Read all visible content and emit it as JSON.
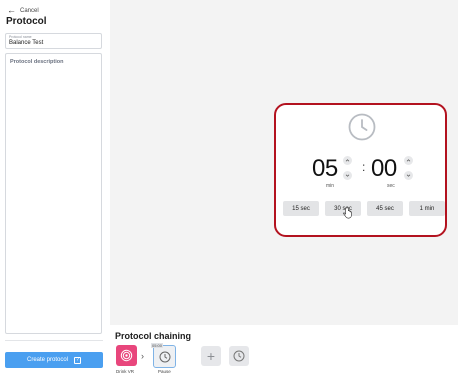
{
  "left_panel": {
    "cancel_label": "Cancel",
    "title": "Protocol",
    "name_field": {
      "caption": "Protocol name",
      "value": "Balance Test"
    },
    "description_field": {
      "placeholder": "Protocol description"
    },
    "create_button_label": "Create protocol"
  },
  "timer": {
    "minutes": "05",
    "seconds": "00",
    "separator": ":",
    "minutes_unit": "min",
    "seconds_unit": "sec",
    "presets": [
      "15 sec",
      "30 sec",
      "45 sec",
      "1 min"
    ]
  },
  "chaining": {
    "title": "Protocol chaining",
    "items": [
      {
        "label": "Drink VR",
        "icon": "vr-app-icon"
      },
      {
        "label": "Pause",
        "icon": "timer-icon",
        "badge": "05:00"
      }
    ],
    "add_icon": "plus-icon",
    "add_timer_icon": "timer-icon"
  },
  "colors": {
    "accent": "#4a9ff0",
    "highlight": "#b3121f",
    "vr_tile": "#e8467c"
  }
}
